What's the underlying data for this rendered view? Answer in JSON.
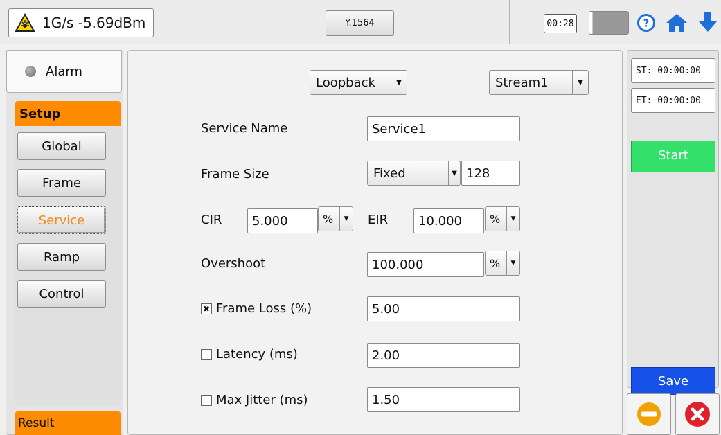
{
  "topbar": {
    "signal_text": "1G/s -5.69dBm",
    "mode_label": "Y.1564",
    "timer": "00:28",
    "icons": [
      "laser-warning-icon",
      "battery-icon",
      "help-icon",
      "home-icon",
      "down-arrow-icon"
    ]
  },
  "sidebar": {
    "alarm_label": "Alarm",
    "setup_header": "Setup",
    "items": [
      {
        "label": "Global"
      },
      {
        "label": "Frame"
      },
      {
        "label": "Service",
        "active": true
      },
      {
        "label": "Ramp"
      },
      {
        "label": "Control"
      }
    ],
    "result_header": "Result"
  },
  "main": {
    "loopback_select": "Loopback",
    "stream_select": "Stream1",
    "service_name_label": "Service Name",
    "service_name_value": "Service1",
    "frame_size_label": "Frame Size",
    "frame_size_mode": "Fixed",
    "frame_size_value": "128",
    "cir_label": "CIR",
    "cir_value": "5.000",
    "cir_unit": "%",
    "eir_label": "EIR",
    "eir_value": "10.000",
    "eir_unit": "%",
    "overshoot_label": "Overshoot",
    "overshoot_value": "100.000",
    "overshoot_unit": "%",
    "frame_loss": {
      "label": "Frame Loss (%)",
      "checked": true,
      "value": "5.00"
    },
    "latency": {
      "label": "Latency (ms)",
      "checked": false,
      "value": "2.00"
    },
    "max_jitter": {
      "label": "Max Jitter (ms)",
      "checked": false,
      "value": "1.50"
    }
  },
  "right": {
    "start_time": "ST:  00:00:00",
    "end_time": "ET:  00:00:00",
    "start_label": "Start",
    "save_label": "Save"
  },
  "colors": {
    "accent_orange": "#ff8c00",
    "start_green": "#33e06a",
    "save_blue": "#1652e8",
    "stop_orange": "#f2a200",
    "close_red": "#e0202a"
  }
}
